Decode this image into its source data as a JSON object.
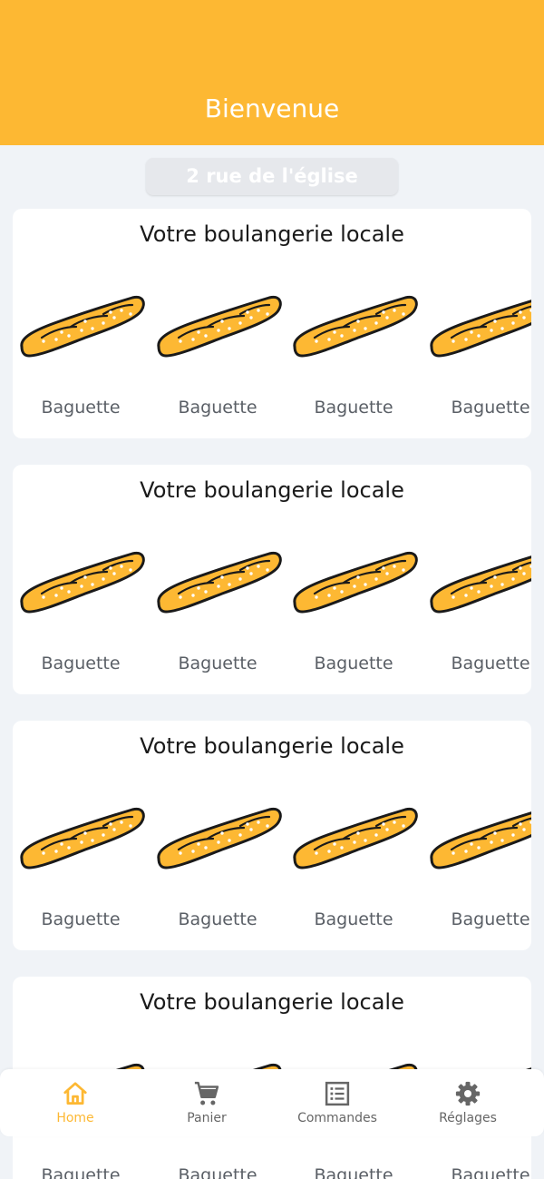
{
  "header": {
    "title": "Bienvenue"
  },
  "address": {
    "label": "2 rue de l'église"
  },
  "sections": [
    {
      "title": "Votre boulangerie locale",
      "products": [
        {
          "name": "Baguette"
        },
        {
          "name": "Baguette"
        },
        {
          "name": "Baguette"
        },
        {
          "name": "Baguette"
        }
      ]
    },
    {
      "title": "Votre boulangerie locale",
      "products": [
        {
          "name": "Baguette"
        },
        {
          "name": "Baguette"
        },
        {
          "name": "Baguette"
        },
        {
          "name": "Baguette"
        }
      ]
    },
    {
      "title": "Votre boulangerie locale",
      "products": [
        {
          "name": "Baguette"
        },
        {
          "name": "Baguette"
        },
        {
          "name": "Baguette"
        },
        {
          "name": "Baguette"
        }
      ]
    },
    {
      "title": "Votre boulangerie locale",
      "products": [
        {
          "name": "Baguette"
        },
        {
          "name": "Baguette"
        },
        {
          "name": "Baguette"
        },
        {
          "name": "Baguette"
        }
      ]
    }
  ],
  "nav": [
    {
      "label": "Home",
      "icon": "home-icon",
      "active": true
    },
    {
      "label": "Panier",
      "icon": "cart-icon",
      "active": false
    },
    {
      "label": "Commandes",
      "icon": "list-icon",
      "active": false
    },
    {
      "label": "Réglages",
      "icon": "gear-icon",
      "active": false
    }
  ],
  "colors": {
    "accent": "#fdb833",
    "background": "#f0f3f7",
    "inactive": "#666666"
  }
}
